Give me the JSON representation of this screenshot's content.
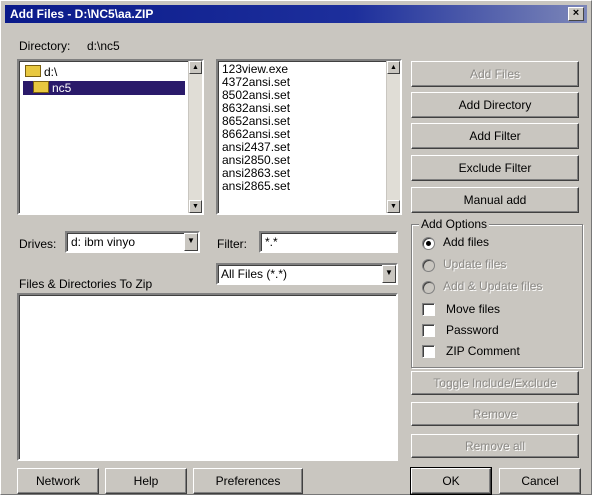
{
  "window": {
    "title": "Add Files - D:\\NC5\\aa.ZIP",
    "close_glyph": "×"
  },
  "directory": {
    "label": "Directory:",
    "value": "d:\\nc5"
  },
  "dir_tree": {
    "items": [
      "d:\\",
      "nc5"
    ],
    "selected": 1
  },
  "file_list": {
    "items": [
      "123view.exe",
      "4372ansi.set",
      "8502ansi.set",
      "8632ansi.set",
      "8652ansi.set",
      "8662ansi.set",
      "ansi2437.set",
      "ansi2850.set",
      "ansi2863.set",
      "ansi2865.set"
    ]
  },
  "drives": {
    "label": "Drives:",
    "value": "d: ibm vinyo"
  },
  "filter": {
    "label": "Filter:",
    "value": "*.*"
  },
  "zip_list": {
    "label": "Files & Directories To Zip",
    "file_type": "All Files (*.*)"
  },
  "buttons": {
    "add_files": "Add Files",
    "add_directory": "Add Directory",
    "add_filter": "Add Filter",
    "exclude_filter": "Exclude Filter",
    "manual_add": "Manual add",
    "toggle": "Toggle Include/Exclude",
    "remove": "Remove",
    "remove_all": "Remove all",
    "network": "Network",
    "help": "Help",
    "preferences": "Preferences",
    "ok": "OK",
    "cancel": "Cancel"
  },
  "add_options": {
    "title": "Add Options",
    "radios": [
      {
        "label": "Add files",
        "checked": true,
        "enabled": true
      },
      {
        "label": "Update files",
        "checked": false,
        "enabled": false
      },
      {
        "label": "Add & Update files",
        "checked": false,
        "enabled": false
      }
    ],
    "checkboxes": [
      {
        "label": "Move files",
        "checked": false
      },
      {
        "label": "Password",
        "checked": false
      },
      {
        "label": "ZIP Comment",
        "checked": false
      }
    ]
  },
  "icons": {
    "folder": "folder-icon",
    "scroll_up": "▲",
    "scroll_down": "▼",
    "dropdown": "▼"
  }
}
